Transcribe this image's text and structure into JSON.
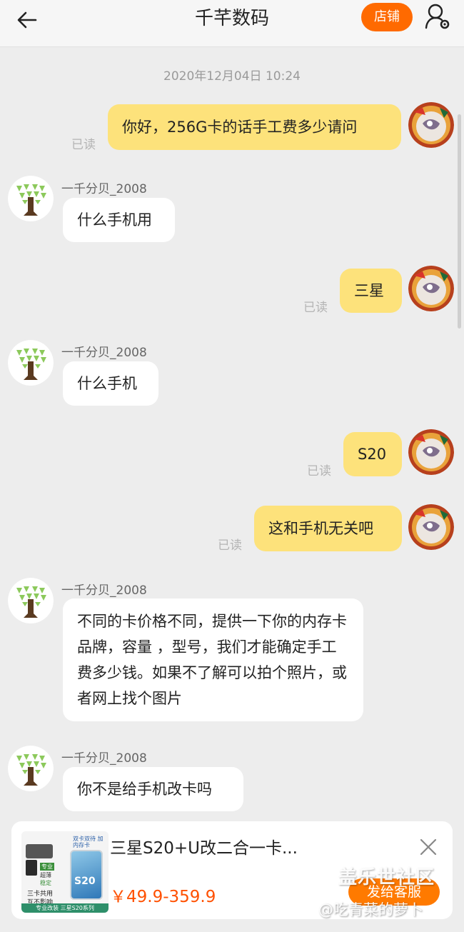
{
  "header": {
    "title": "千芊数码",
    "shop_label": "店铺"
  },
  "chat": {
    "timestamp": "2020年12月04日 10:24",
    "read_label": "已读",
    "partner_name": "一千分贝_2008",
    "messages": [
      {
        "from": "me",
        "text": "你好，256G卡的话手工费多少请问"
      },
      {
        "from": "them",
        "text": "什么手机用"
      },
      {
        "from": "me",
        "text": "三星"
      },
      {
        "from": "them",
        "text": "什么手机"
      },
      {
        "from": "me",
        "text": "S20"
      },
      {
        "from": "me",
        "text": "这和手机无关吧"
      },
      {
        "from": "them",
        "text": "不同的卡价格不同，提供一下你的内存卡品牌，容量 ，型号，我们才能确定手工费多少钱。如果不了解可以拍个照片，或者网上找个图片"
      },
      {
        "from": "them",
        "text": "你不是给手机改卡吗"
      }
    ]
  },
  "product_card": {
    "title": "三星S20+U改二合一卡...",
    "price": "￥49.9-359.9",
    "send_label": "发给客服",
    "thumb": {
      "top_tag": "双卡双待 加内存卡",
      "badge1": "专业",
      "badge2": "超薄",
      "badge3": "稳定",
      "line1": "三卡共用",
      "line2": "互不影响",
      "phone_label": "S20",
      "footer": "专业改装 三星S20系列"
    }
  },
  "watermark": {
    "line1": "盖乐世社区",
    "line2": "@吃青菜的萝卜"
  },
  "colors": {
    "accent": "#ff6a00",
    "my_bubble": "#fde27b",
    "their_bubble": "#ffffff",
    "price": "#ff5000"
  }
}
